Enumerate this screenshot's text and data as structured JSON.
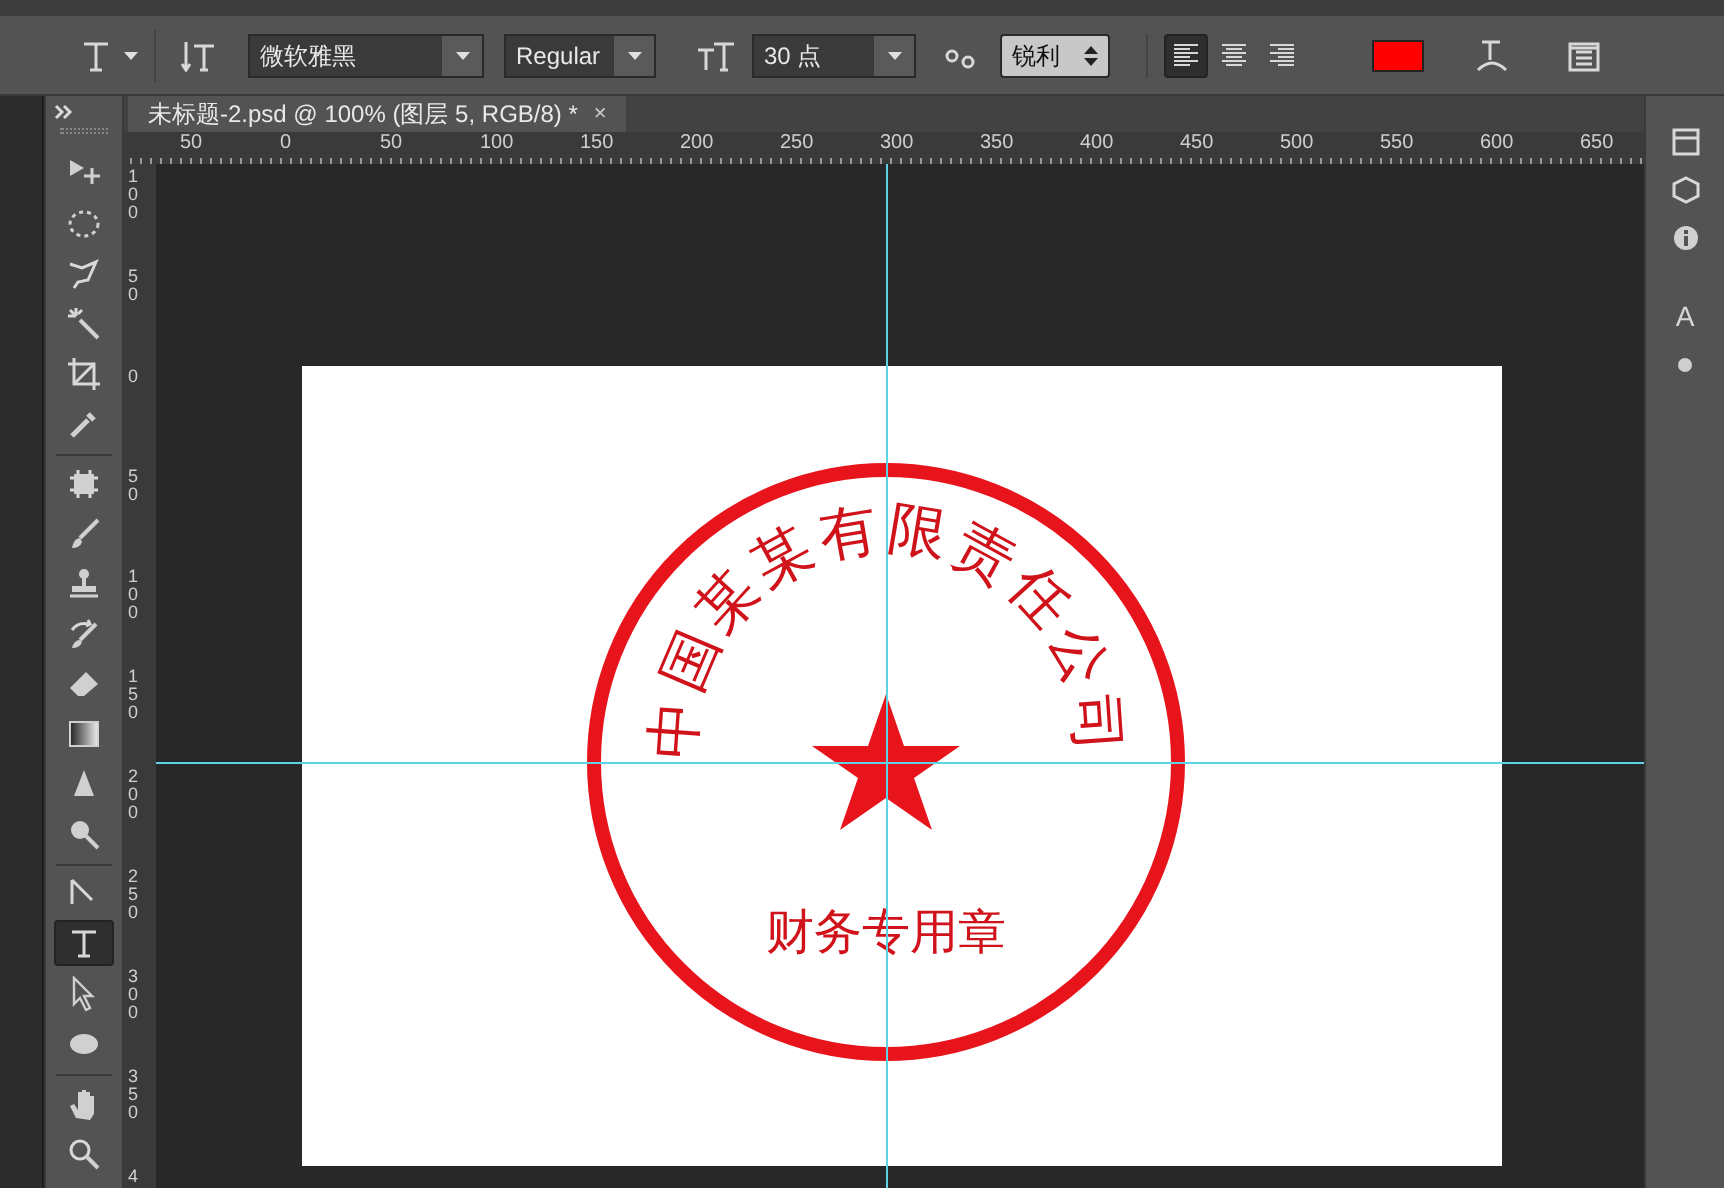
{
  "options_bar": {
    "font_family": "微软雅黑",
    "font_style": "Regular",
    "font_size": "30 点",
    "antialias": "锐利",
    "alignment": [
      {
        "kind": "left",
        "selected": true
      },
      {
        "kind": "center",
        "selected": false
      },
      {
        "kind": "right",
        "selected": false
      }
    ],
    "text_color": {
      "color": "#ff0000"
    }
  },
  "document_tab": {
    "title": "未标题-2.psd @ 100% (图层 5, RGB/8) *",
    "close": "×"
  },
  "rulers": {
    "horizontal": [
      "50",
      "0",
      "50",
      "100",
      "150",
      "200",
      "250",
      "300",
      "350",
      "400",
      "450",
      "500",
      "550",
      "600",
      "650"
    ],
    "vertical": [
      "100",
      "50",
      "0",
      "50",
      "100",
      "150",
      "200",
      "250",
      "300",
      "350",
      "4"
    ]
  },
  "tools": [
    {
      "kind": "move",
      "selected": false
    },
    {
      "kind": "marquee",
      "selected": false
    },
    {
      "kind": "lasso",
      "selected": false
    },
    {
      "kind": "wand",
      "selected": false
    },
    {
      "kind": "crop",
      "selected": false
    },
    {
      "kind": "eyedropper",
      "selected": false
    },
    {
      "kind": "healing",
      "selected": false
    },
    {
      "kind": "brush",
      "selected": false
    },
    {
      "kind": "stamp",
      "selected": false
    },
    {
      "kind": "history",
      "selected": false
    },
    {
      "kind": "eraser",
      "selected": false
    },
    {
      "kind": "gradient",
      "selected": false
    },
    {
      "kind": "blur",
      "selected": false
    },
    {
      "kind": "dodge",
      "selected": false
    },
    {
      "kind": "pen",
      "selected": false
    },
    {
      "kind": "type",
      "selected": true
    },
    {
      "kind": "select",
      "selected": false
    },
    {
      "kind": "ellipse",
      "selected": false
    },
    {
      "kind": "hand",
      "selected": false
    },
    {
      "kind": "zoom",
      "selected": false
    }
  ],
  "seal": {
    "arc_text": "中国某某有限责任公司",
    "bottom_text": "财务专用章"
  },
  "right_panel": {
    "label": "A"
  }
}
